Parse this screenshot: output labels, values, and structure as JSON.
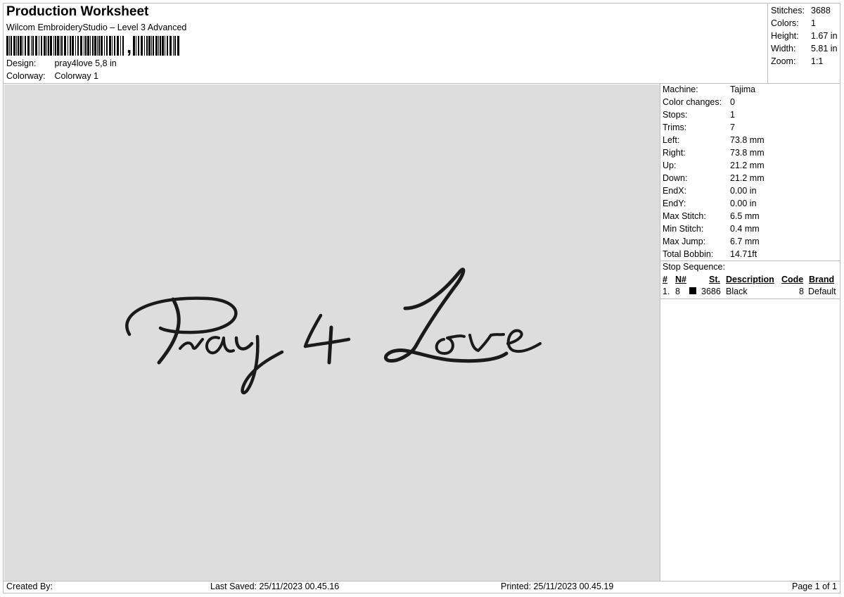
{
  "header": {
    "title": "Production Worksheet",
    "subtitle": "Wilcom EmbroideryStudio – Level 3 Advanced",
    "barcode_text": ",",
    "design_label": "Design:",
    "design_value": "pray4love 5,8 in",
    "colorway_label": "Colorway:",
    "colorway_value": "Colorway 1"
  },
  "stats": [
    {
      "label": "Stitches:",
      "value": "3688"
    },
    {
      "label": "Colors:",
      "value": "1"
    },
    {
      "label": "Height:",
      "value": "1.67 in"
    },
    {
      "label": "Width:",
      "value": "5.81 in"
    },
    {
      "label": "Zoom:",
      "value": "1:1"
    }
  ],
  "design_preview": {
    "text": "Pray 4 Love",
    "thread_color": "#1a1a1a",
    "background_color": "#dddddd"
  },
  "machine_info": [
    {
      "label": "Machine:",
      "value": "Tajima"
    },
    {
      "label": "Color changes:",
      "value": "0"
    },
    {
      "label": "Stops:",
      "value": "1"
    },
    {
      "label": "Trims:",
      "value": "7"
    },
    {
      "label": "Left:",
      "value": "73.8 mm"
    },
    {
      "label": "Right:",
      "value": "73.8 mm"
    },
    {
      "label": "Up:",
      "value": "21.2 mm"
    },
    {
      "label": "Down:",
      "value": "21.2 mm"
    },
    {
      "label": "EndX:",
      "value": "0.00 in"
    },
    {
      "label": "EndY:",
      "value": "0.00 in"
    },
    {
      "label": "Max Stitch:",
      "value": "6.5 mm"
    },
    {
      "label": "Min Stitch:",
      "value": "0.4 mm"
    },
    {
      "label": "Max Jump:",
      "value": "6.7 mm"
    },
    {
      "label": "Total Bobbin:",
      "value": "14.71ft"
    }
  ],
  "stop_sequence": {
    "title": "Stop Sequence:",
    "columns": {
      "num": "#",
      "needle": "N#",
      "stitches": "St.",
      "description": "Description",
      "code": "Code",
      "brand": "Brand"
    },
    "rows": [
      {
        "num": "1.",
        "needle": "8",
        "swatch_color": "#000000",
        "stitches": "3686",
        "description": "Black",
        "code": "8",
        "brand": "Default"
      }
    ]
  },
  "footer": {
    "created_by": "Created By:",
    "last_saved": "Last Saved: 25/11/2023 00.45.16",
    "printed": "Printed: 25/11/2023 00.45.19",
    "page": "Page 1 of 1"
  }
}
